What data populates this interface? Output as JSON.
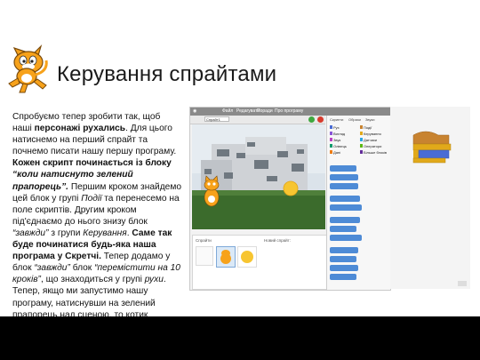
{
  "slide": {
    "title": "Керування спрайтами",
    "body": [
      {
        "t": "Спробуємо тепер зробити так, щоб наші ",
        "b": false,
        "i": false
      },
      {
        "t": "персонажі рухались",
        "b": true,
        "i": false
      },
      {
        "t": ". Для цього натиснемо на перший спрайт та почнемо писати нашу першу програму. ",
        "b": false,
        "i": false
      },
      {
        "t": "Кожен скрипт починається із блоку ",
        "b": true,
        "i": false
      },
      {
        "t": "“коли натиснуто зелений прапорець”.",
        "b": true,
        "i": true
      },
      {
        "t": " Першим кроком знайдемо цей блок у групі ",
        "b": false,
        "i": false
      },
      {
        "t": "Події",
        "b": false,
        "i": true
      },
      {
        "t": " та перенесемо на поле скриптів. Другим кроком під'єднаємо до нього знизу блок ",
        "b": false,
        "i": false
      },
      {
        "t": "“завжди”",
        "b": false,
        "i": true
      },
      {
        "t": " з групи ",
        "b": false,
        "i": false
      },
      {
        "t": "Керування",
        "b": false,
        "i": true
      },
      {
        "t": ". ",
        "b": false,
        "i": false
      },
      {
        "t": "Саме так буде починатися будь-яка наша програма у Скретчі.",
        "b": true,
        "i": false
      },
      {
        "t": " Тепер додамо у блок ",
        "b": false,
        "i": false
      },
      {
        "t": "“завжди”",
        "b": false,
        "i": true
      },
      {
        "t": " блок ",
        "b": false,
        "i": false
      },
      {
        "t": "“перемістити на 10 кроків”",
        "b": false,
        "i": true
      },
      {
        "t": ", що знаходиться у групі ",
        "b": false,
        "i": false
      },
      {
        "t": "рухи",
        "b": false,
        "i": true
      },
      {
        "t": ". Тепер, якщо ми запустимо нашу програму, натиснувши на зелений прапорець над сценою, то котик",
        "b": false,
        "i": false
      }
    ]
  },
  "screenshot": {
    "menu": [
      "Файл",
      "Редагувати",
      "Поради",
      "Про програму"
    ],
    "sprite_name": "Спрайт1",
    "sprites_label": "Спрайти",
    "new_sprite_label": "Новий спрайт:",
    "tabs": [
      "Скрипти",
      "Образи",
      "Звуки"
    ],
    "categories": [
      {
        "label": "Рух",
        "color": "#4a6cd4"
      },
      {
        "label": "Вигляд",
        "color": "#8a55d7"
      },
      {
        "label": "Звук",
        "color": "#bb42c3"
      },
      {
        "label": "Олівець",
        "color": "#0e9a6c"
      },
      {
        "label": "Дані",
        "color": "#ee7d16"
      },
      {
        "label": "Події",
        "color": "#c88330"
      },
      {
        "label": "Керування",
        "color": "#e1a91a"
      },
      {
        "label": "Датчики",
        "color": "#2ca5e2"
      },
      {
        "label": "Оператори",
        "color": "#5cb712"
      },
      {
        "label": "Більше блоків",
        "color": "#632d99"
      }
    ],
    "colors": {
      "hat": "#c88330",
      "forever": "#e1a91a",
      "motion": "#4a6cd4"
    }
  }
}
